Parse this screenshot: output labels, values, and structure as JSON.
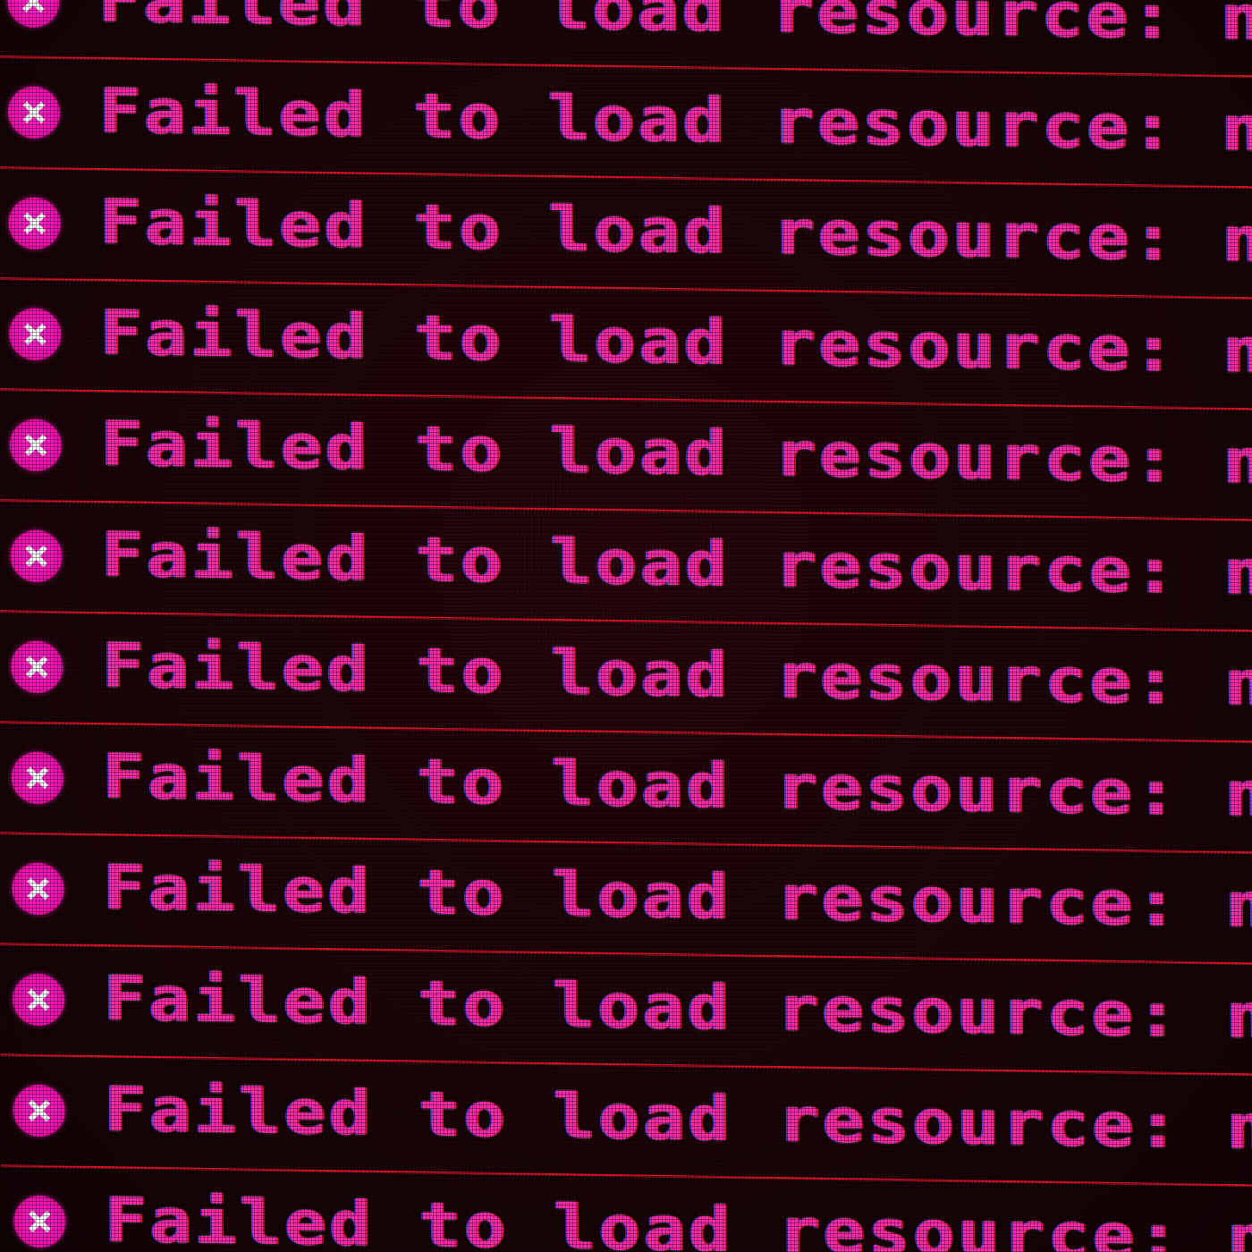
{
  "console": {
    "entries": [
      {
        "level": "error",
        "message": "Failed to load resource: net::ERR"
      },
      {
        "level": "error",
        "message": "Failed to load resource: net::ER"
      },
      {
        "level": "error",
        "message": "Failed to load resource: net::ER"
      },
      {
        "level": "error",
        "message": "Failed to load resource: net::ER"
      },
      {
        "level": "error",
        "message": "Failed to load resource: net::ER"
      },
      {
        "level": "error",
        "message": "Failed to load resource: net::ER"
      },
      {
        "level": "error",
        "message": "Failed to load resource: net::ER"
      },
      {
        "level": "error",
        "message": "Failed to load resource: net::ER"
      },
      {
        "level": "error",
        "message": "Failed to load resource: net::ER"
      },
      {
        "level": "error",
        "message": "Failed to load resource: net::ER"
      },
      {
        "level": "error",
        "message": "Failed to load resource: net::ER"
      },
      {
        "level": "error",
        "message": "Failed to load resource: net::ER"
      }
    ],
    "icon": "error-x-circle-icon"
  },
  "colors": {
    "background": "#1c0508",
    "text": "#ff2aa8",
    "icon": "#ff10b8",
    "divider": "#e0102a"
  }
}
